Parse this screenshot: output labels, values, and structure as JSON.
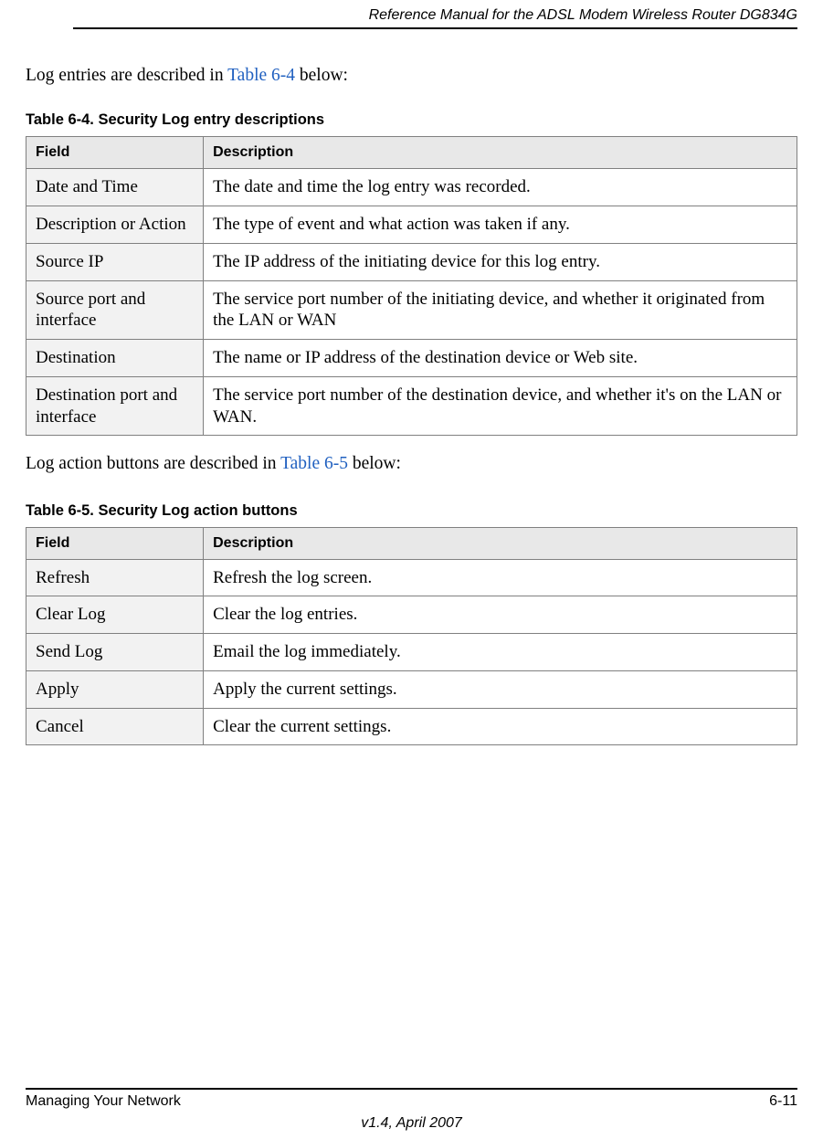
{
  "header": {
    "title": "Reference Manual for the ADSL Modem Wireless Router DG834G"
  },
  "para1_pre": "Log entries are described in ",
  "para1_ref": "Table 6-4",
  "para1_post": " below:",
  "table1": {
    "caption": "Table 6-4. Security Log entry descriptions",
    "head_field": "Field",
    "head_desc": "Description",
    "rows": [
      {
        "field": "Date and Time",
        "desc": "The date and time the log entry was recorded."
      },
      {
        "field": "Description or Action",
        "desc": "The type of event and what action was taken if any."
      },
      {
        "field": "Source IP",
        "desc": "The IP address of the initiating device for this log entry."
      },
      {
        "field": "Source port and interface",
        "desc": "The service port number of the initiating device, and whether it originated from the LAN or WAN"
      },
      {
        "field": "Destination",
        "desc": "The name or IP address of the destination device or Web site."
      },
      {
        "field": "Destination port and interface",
        "desc": "The service port number of the destination device, and whether it's on the LAN or WAN."
      }
    ]
  },
  "para2_pre": "Log action buttons are described in ",
  "para2_ref": "Table 6-5",
  "para2_post": " below:",
  "table2": {
    "caption": "Table 6-5. Security Log action buttons",
    "head_field": "Field",
    "head_desc": "Description",
    "rows": [
      {
        "field": "Refresh",
        "desc": "Refresh the log screen."
      },
      {
        "field": "Clear Log",
        "desc": "Clear the log entries."
      },
      {
        "field": "Send Log",
        "desc": "Email the log immediately."
      },
      {
        "field": "Apply",
        "desc": "Apply the current settings."
      },
      {
        "field": "Cancel",
        "desc": "Clear the current settings."
      }
    ]
  },
  "footer": {
    "left": "Managing Your Network",
    "right": "6-11",
    "center": "v1.4, April 2007"
  }
}
